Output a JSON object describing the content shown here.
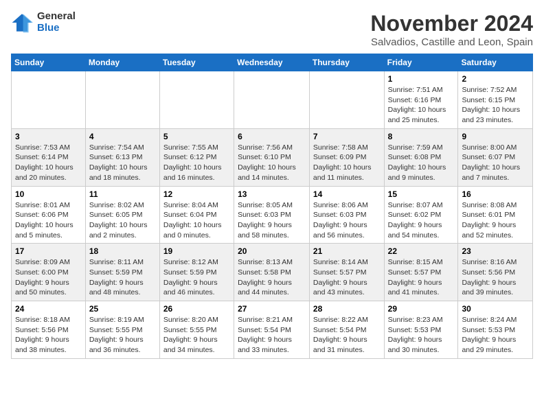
{
  "logo": {
    "general": "General",
    "blue": "Blue"
  },
  "title": "November 2024",
  "location": "Salvadios, Castille and Leon, Spain",
  "weekdays": [
    "Sunday",
    "Monday",
    "Tuesday",
    "Wednesday",
    "Thursday",
    "Friday",
    "Saturday"
  ],
  "weeks": [
    [
      {
        "day": "",
        "info": ""
      },
      {
        "day": "",
        "info": ""
      },
      {
        "day": "",
        "info": ""
      },
      {
        "day": "",
        "info": ""
      },
      {
        "day": "",
        "info": ""
      },
      {
        "day": "1",
        "info": "Sunrise: 7:51 AM\nSunset: 6:16 PM\nDaylight: 10 hours and 25 minutes."
      },
      {
        "day": "2",
        "info": "Sunrise: 7:52 AM\nSunset: 6:15 PM\nDaylight: 10 hours and 23 minutes."
      }
    ],
    [
      {
        "day": "3",
        "info": "Sunrise: 7:53 AM\nSunset: 6:14 PM\nDaylight: 10 hours and 20 minutes."
      },
      {
        "day": "4",
        "info": "Sunrise: 7:54 AM\nSunset: 6:13 PM\nDaylight: 10 hours and 18 minutes."
      },
      {
        "day": "5",
        "info": "Sunrise: 7:55 AM\nSunset: 6:12 PM\nDaylight: 10 hours and 16 minutes."
      },
      {
        "day": "6",
        "info": "Sunrise: 7:56 AM\nSunset: 6:10 PM\nDaylight: 10 hours and 14 minutes."
      },
      {
        "day": "7",
        "info": "Sunrise: 7:58 AM\nSunset: 6:09 PM\nDaylight: 10 hours and 11 minutes."
      },
      {
        "day": "8",
        "info": "Sunrise: 7:59 AM\nSunset: 6:08 PM\nDaylight: 10 hours and 9 minutes."
      },
      {
        "day": "9",
        "info": "Sunrise: 8:00 AM\nSunset: 6:07 PM\nDaylight: 10 hours and 7 minutes."
      }
    ],
    [
      {
        "day": "10",
        "info": "Sunrise: 8:01 AM\nSunset: 6:06 PM\nDaylight: 10 hours and 5 minutes."
      },
      {
        "day": "11",
        "info": "Sunrise: 8:02 AM\nSunset: 6:05 PM\nDaylight: 10 hours and 2 minutes."
      },
      {
        "day": "12",
        "info": "Sunrise: 8:04 AM\nSunset: 6:04 PM\nDaylight: 10 hours and 0 minutes."
      },
      {
        "day": "13",
        "info": "Sunrise: 8:05 AM\nSunset: 6:03 PM\nDaylight: 9 hours and 58 minutes."
      },
      {
        "day": "14",
        "info": "Sunrise: 8:06 AM\nSunset: 6:03 PM\nDaylight: 9 hours and 56 minutes."
      },
      {
        "day": "15",
        "info": "Sunrise: 8:07 AM\nSunset: 6:02 PM\nDaylight: 9 hours and 54 minutes."
      },
      {
        "day": "16",
        "info": "Sunrise: 8:08 AM\nSunset: 6:01 PM\nDaylight: 9 hours and 52 minutes."
      }
    ],
    [
      {
        "day": "17",
        "info": "Sunrise: 8:09 AM\nSunset: 6:00 PM\nDaylight: 9 hours and 50 minutes."
      },
      {
        "day": "18",
        "info": "Sunrise: 8:11 AM\nSunset: 5:59 PM\nDaylight: 9 hours and 48 minutes."
      },
      {
        "day": "19",
        "info": "Sunrise: 8:12 AM\nSunset: 5:59 PM\nDaylight: 9 hours and 46 minutes."
      },
      {
        "day": "20",
        "info": "Sunrise: 8:13 AM\nSunset: 5:58 PM\nDaylight: 9 hours and 44 minutes."
      },
      {
        "day": "21",
        "info": "Sunrise: 8:14 AM\nSunset: 5:57 PM\nDaylight: 9 hours and 43 minutes."
      },
      {
        "day": "22",
        "info": "Sunrise: 8:15 AM\nSunset: 5:57 PM\nDaylight: 9 hours and 41 minutes."
      },
      {
        "day": "23",
        "info": "Sunrise: 8:16 AM\nSunset: 5:56 PM\nDaylight: 9 hours and 39 minutes."
      }
    ],
    [
      {
        "day": "24",
        "info": "Sunrise: 8:18 AM\nSunset: 5:56 PM\nDaylight: 9 hours and 38 minutes."
      },
      {
        "day": "25",
        "info": "Sunrise: 8:19 AM\nSunset: 5:55 PM\nDaylight: 9 hours and 36 minutes."
      },
      {
        "day": "26",
        "info": "Sunrise: 8:20 AM\nSunset: 5:55 PM\nDaylight: 9 hours and 34 minutes."
      },
      {
        "day": "27",
        "info": "Sunrise: 8:21 AM\nSunset: 5:54 PM\nDaylight: 9 hours and 33 minutes."
      },
      {
        "day": "28",
        "info": "Sunrise: 8:22 AM\nSunset: 5:54 PM\nDaylight: 9 hours and 31 minutes."
      },
      {
        "day": "29",
        "info": "Sunrise: 8:23 AM\nSunset: 5:53 PM\nDaylight: 9 hours and 30 minutes."
      },
      {
        "day": "30",
        "info": "Sunrise: 8:24 AM\nSunset: 5:53 PM\nDaylight: 9 hours and 29 minutes."
      }
    ]
  ]
}
